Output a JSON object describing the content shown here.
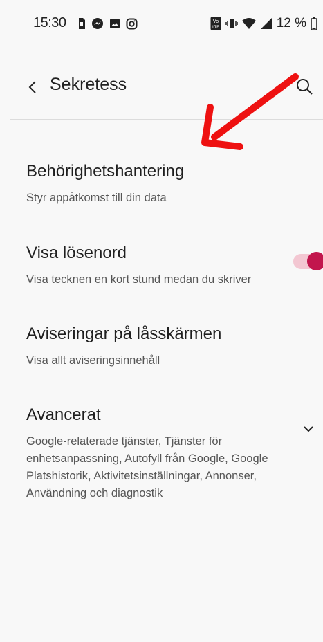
{
  "status_bar": {
    "time": "15:30",
    "battery": "12 %",
    "left_icons": [
      "sim-icon",
      "messenger-icon",
      "gallery-icon",
      "instagram-icon"
    ],
    "right_icons": [
      "volte-icon",
      "vibrate-icon",
      "wifi-icon",
      "signal-icon",
      "battery-icon"
    ]
  },
  "toolbar": {
    "title": "Sekretess",
    "back_icon": "back-chevron-icon",
    "search_icon": "search-icon"
  },
  "settings": [
    {
      "title": "Behörighetshantering",
      "summary": "Styr appåtkomst till din data"
    },
    {
      "title": "Visa lösenord",
      "summary": "Visa tecknen en kort stund medan du skriver",
      "toggle_on": true
    },
    {
      "title": "Aviseringar på låsskärmen",
      "summary": "Visa allt aviseringsinnehåll"
    },
    {
      "title": "Avancerat",
      "summary": "Google-relaterade tjänster, Tjänster för enhetsanpassning, Autofyll från Google, Google Platshistorik, Aktivitetsinställningar, Annonser, Användning och diagnostik",
      "expand_icon": "chevron-down-icon"
    }
  ],
  "colors": {
    "background": "#f8f8f8",
    "accent": "#c2164d",
    "toggle_track": "#f3c7d2",
    "annotation_arrow": "#ee1111"
  }
}
